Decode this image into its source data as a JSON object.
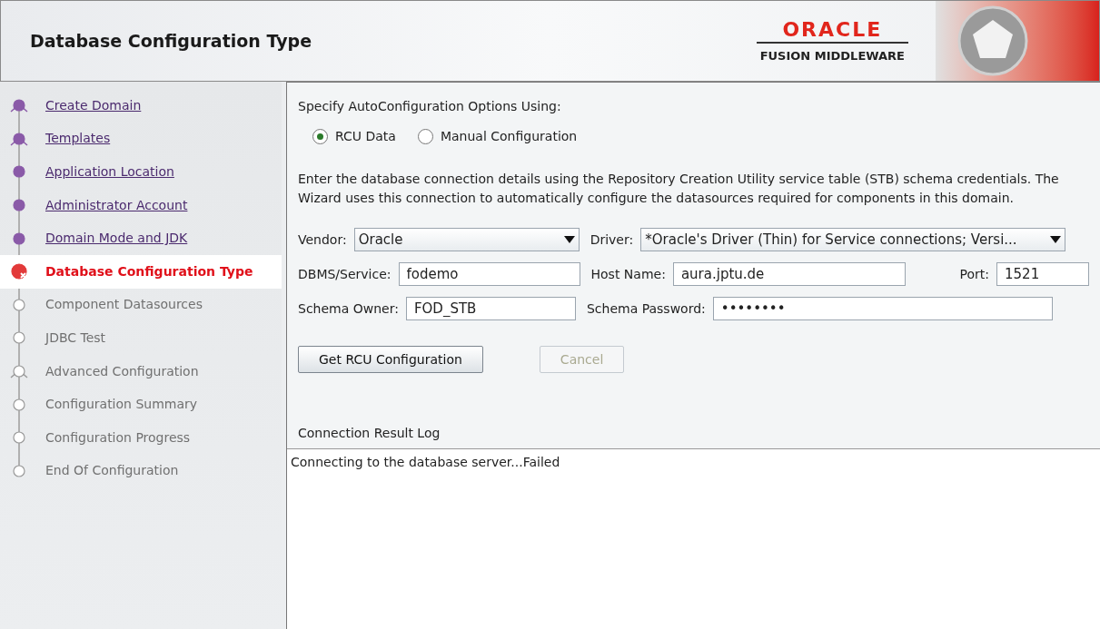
{
  "header": {
    "title": "Database Configuration Type",
    "logo_brand": "ORACLE",
    "logo_product": "FUSION MIDDLEWARE"
  },
  "steps": [
    {
      "label": "Create Domain",
      "visited": true,
      "kind": "branch",
      "selected": false
    },
    {
      "label": "Templates",
      "visited": true,
      "kind": "branch",
      "selected": false
    },
    {
      "label": "Application Location",
      "visited": true,
      "kind": "step",
      "selected": false
    },
    {
      "label": "Administrator Account",
      "visited": true,
      "kind": "step",
      "selected": false
    },
    {
      "label": "Domain Mode and JDK",
      "visited": true,
      "kind": "step",
      "selected": false
    },
    {
      "label": "Database Configuration Type",
      "visited": false,
      "kind": "step",
      "selected": true
    },
    {
      "label": "Component Datasources",
      "visited": false,
      "kind": "step",
      "selected": false
    },
    {
      "label": "JDBC Test",
      "visited": false,
      "kind": "step",
      "selected": false
    },
    {
      "label": "Advanced Configuration",
      "visited": false,
      "kind": "branch",
      "selected": false
    },
    {
      "label": "Configuration Summary",
      "visited": false,
      "kind": "step",
      "selected": false
    },
    {
      "label": "Configuration Progress",
      "visited": false,
      "kind": "step",
      "selected": false
    },
    {
      "label": "End Of Configuration",
      "visited": false,
      "kind": "step",
      "selected": false
    }
  ],
  "options": {
    "label": "Specify AutoConfiguration Options Using:",
    "radios": [
      {
        "label": "RCU Data",
        "selected": true
      },
      {
        "label": "Manual Configuration",
        "selected": false
      }
    ]
  },
  "description": "Enter the database connection details using the Repository Creation Utility service table (STB) schema credentials. The Wizard uses this connection to automatically configure the datasources required for components in this domain.",
  "form": {
    "vendor": {
      "label": "Vendor:",
      "value": "Oracle"
    },
    "driver": {
      "label": "Driver:",
      "value": "*Oracle's Driver (Thin) for Service connections; Versi..."
    },
    "dbms": {
      "label": "DBMS/Service:",
      "value": "fodemo"
    },
    "host": {
      "label": "Host Name:",
      "value": "aura.jptu.de"
    },
    "port": {
      "label": "Port:",
      "value": "1521"
    },
    "owner": {
      "label": "Schema Owner:",
      "value": "FOD_STB"
    },
    "password": {
      "label": "Schema Password:",
      "value": "••••••••"
    }
  },
  "buttons": [
    {
      "label": "Get RCU Configuration",
      "disabled": false
    },
    {
      "label": "Cancel",
      "disabled": true
    }
  ],
  "log": {
    "label": "Connection Result Log",
    "lines": [
      "Connecting to the database server...Failed"
    ]
  }
}
